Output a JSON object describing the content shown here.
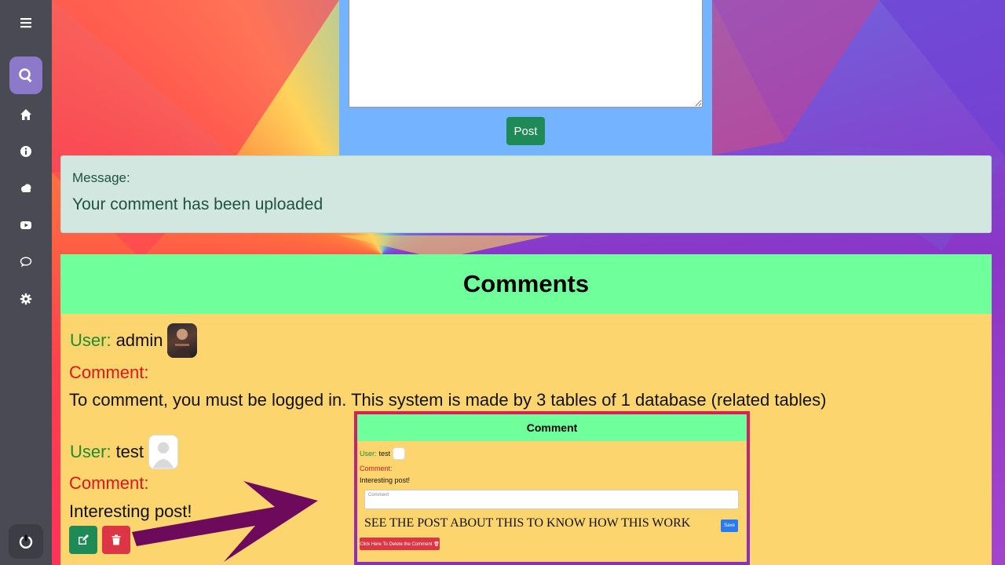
{
  "sidebar": {
    "items": [
      {
        "icon": "menu-icon"
      },
      {
        "icon": "search-icon"
      },
      {
        "icon": "home-icon"
      },
      {
        "icon": "info-icon"
      },
      {
        "icon": "cloud-icon"
      },
      {
        "icon": "youtube-icon"
      },
      {
        "icon": "comment-icon"
      },
      {
        "icon": "gear-icon"
      },
      {
        "icon": "power-icon"
      }
    ],
    "active_color": "#8d79c9"
  },
  "form": {
    "post_label": "Post"
  },
  "message": {
    "label": "Message:",
    "text": "Your comment has been uploaded"
  },
  "comments": {
    "title": "Comments",
    "user_label": "User:",
    "comment_label": "Comment:",
    "items": [
      {
        "user": "admin",
        "text": "To comment, you must be logged in. This system is made by 3 tables of 1 database (related tables)"
      },
      {
        "user": "test",
        "text": "Interesting post!"
      }
    ]
  },
  "embed": {
    "title": "Comment",
    "user_label": "User:",
    "user": "test",
    "comment_label": "Comment:",
    "comment_text": "Interesting post!",
    "input_placeholder": "Comment",
    "note": "SEE THE POST ABOUT THIS TO KNOW HOW THIS WORK",
    "save_label": "Save",
    "delete_label": "Click Here To Delete the Comment 🗑"
  },
  "colors": {
    "sidebar": "#4a4a55",
    "form_panel": "#74b3ff",
    "post_button": "#1e8a55",
    "message_bg": "#d2e7df",
    "comments_header": "#6fff9b",
    "comments_body": "#fdd56f",
    "user_label": "#1f8d2d",
    "comment_label": "#e3141b",
    "delete_button": "#dc3545",
    "arrow": "#6e0a5c"
  }
}
